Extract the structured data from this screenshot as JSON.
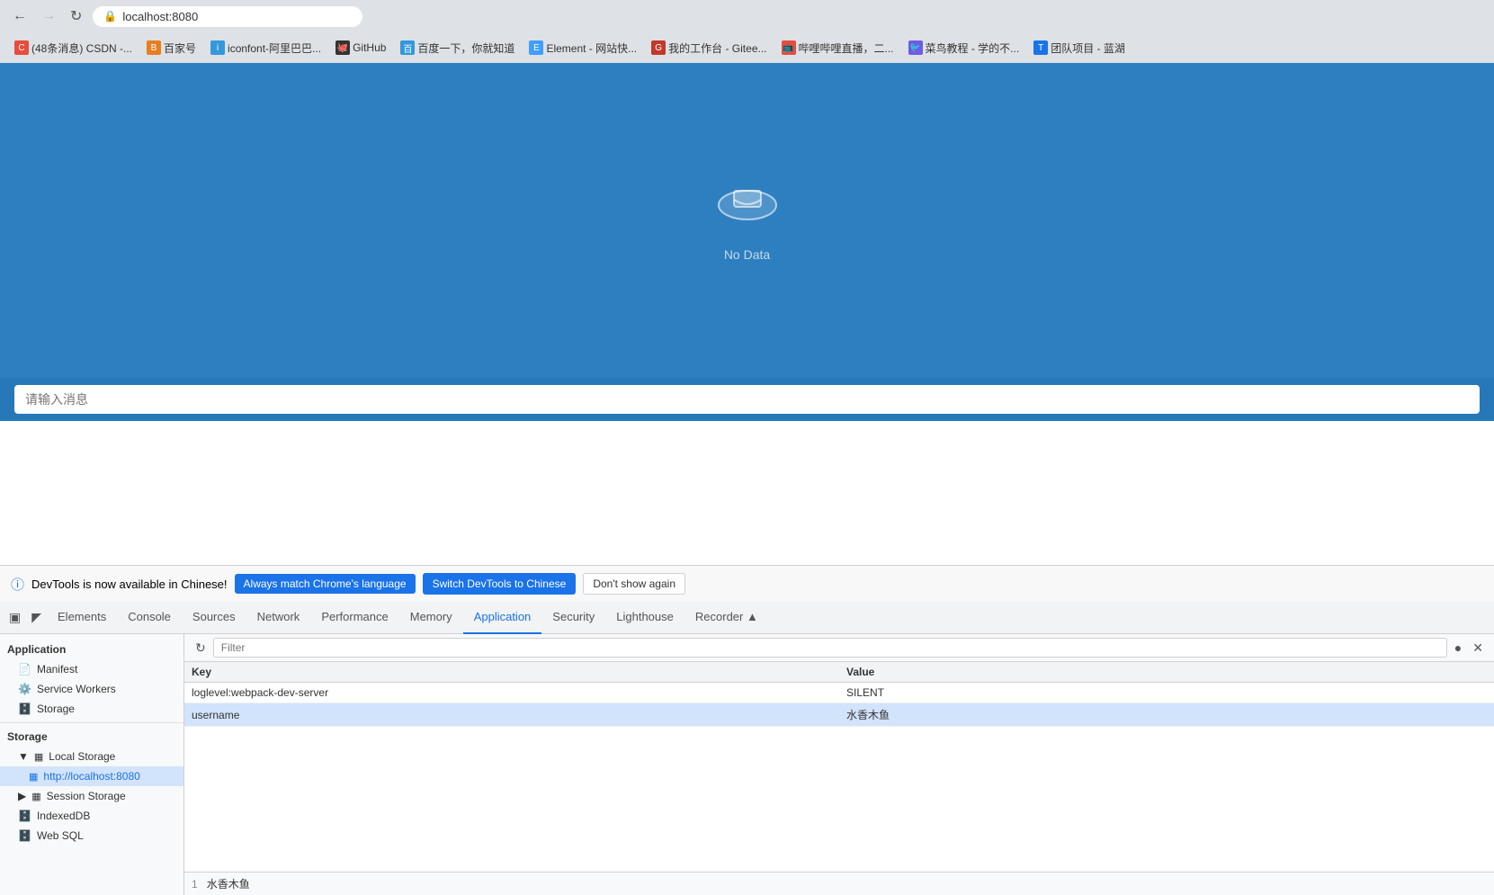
{
  "browser": {
    "url": "localhost:8080",
    "back_disabled": false,
    "forward_disabled": true
  },
  "bookmarks": [
    {
      "label": "(48条消息) CSDN -...",
      "color": "#e74c3c"
    },
    {
      "label": "百家号",
      "color": "#e67e22"
    },
    {
      "label": "iconfont-阿里巴巴...",
      "color": "#3498db"
    },
    {
      "label": "GitHub",
      "color": "#333"
    },
    {
      "label": "百度一下，你就知道",
      "color": "#3498db"
    },
    {
      "label": "Element - 网站快...",
      "color": "#409eff"
    },
    {
      "label": "我的工作台 - Gitee...",
      "color": "#c0392b"
    },
    {
      "label": "哔哩哔哩直播，二...",
      "color": "#e74c3c"
    },
    {
      "label": "菜鸟教程 - 学的不...",
      "color": "#6c5ce7"
    },
    {
      "label": "团队项目 - 蓝湖",
      "color": "#1a73e8"
    }
  ],
  "app": {
    "no_data_text": "No Data",
    "chat_input_placeholder": "请输入消息"
  },
  "devtools_notification": {
    "message": "DevTools is now available in Chinese!",
    "btn1": "Always match Chrome's language",
    "btn2": "Switch DevTools to Chinese",
    "btn3": "Don't show again"
  },
  "devtools_tabs": [
    {
      "label": "Elements",
      "active": false
    },
    {
      "label": "Console",
      "active": false
    },
    {
      "label": "Sources",
      "active": false
    },
    {
      "label": "Network",
      "active": false
    },
    {
      "label": "Performance",
      "active": false
    },
    {
      "label": "Memory",
      "active": false
    },
    {
      "label": "Application",
      "active": true
    },
    {
      "label": "Security",
      "active": false
    },
    {
      "label": "Lighthouse",
      "active": false
    },
    {
      "label": "Recorder ▲",
      "active": false
    }
  ],
  "sidebar": {
    "app_section": "Application",
    "items_app": [
      {
        "label": "Manifest",
        "icon": "📄",
        "indent": 1
      },
      {
        "label": "Service Workers",
        "icon": "⚙️",
        "indent": 1
      },
      {
        "label": "Storage",
        "icon": "🗄️",
        "indent": 1
      }
    ],
    "storage_section": "Storage",
    "items_storage": [
      {
        "label": "Local Storage",
        "icon": "▦",
        "indent": 1,
        "expanded": true
      },
      {
        "label": "http://localhost:8080",
        "icon": "▦",
        "indent": 2,
        "active": true
      },
      {
        "label": "Session Storage",
        "icon": "▦",
        "indent": 1,
        "expanded": false
      },
      {
        "label": "IndexedDB",
        "icon": "🗄️",
        "indent": 1
      },
      {
        "label": "Web SQL",
        "icon": "🗄️",
        "indent": 1
      }
    ]
  },
  "filter": {
    "placeholder": "Filter"
  },
  "table": {
    "col_key": "Key",
    "col_value": "Value",
    "rows": [
      {
        "key": "loglevel:webpack-dev-server",
        "value": "SILENT"
      },
      {
        "key": "username",
        "value": "水香木鱼",
        "selected": true
      }
    ]
  },
  "bottom_row": {
    "number": "1",
    "value": "水香木鱼"
  }
}
